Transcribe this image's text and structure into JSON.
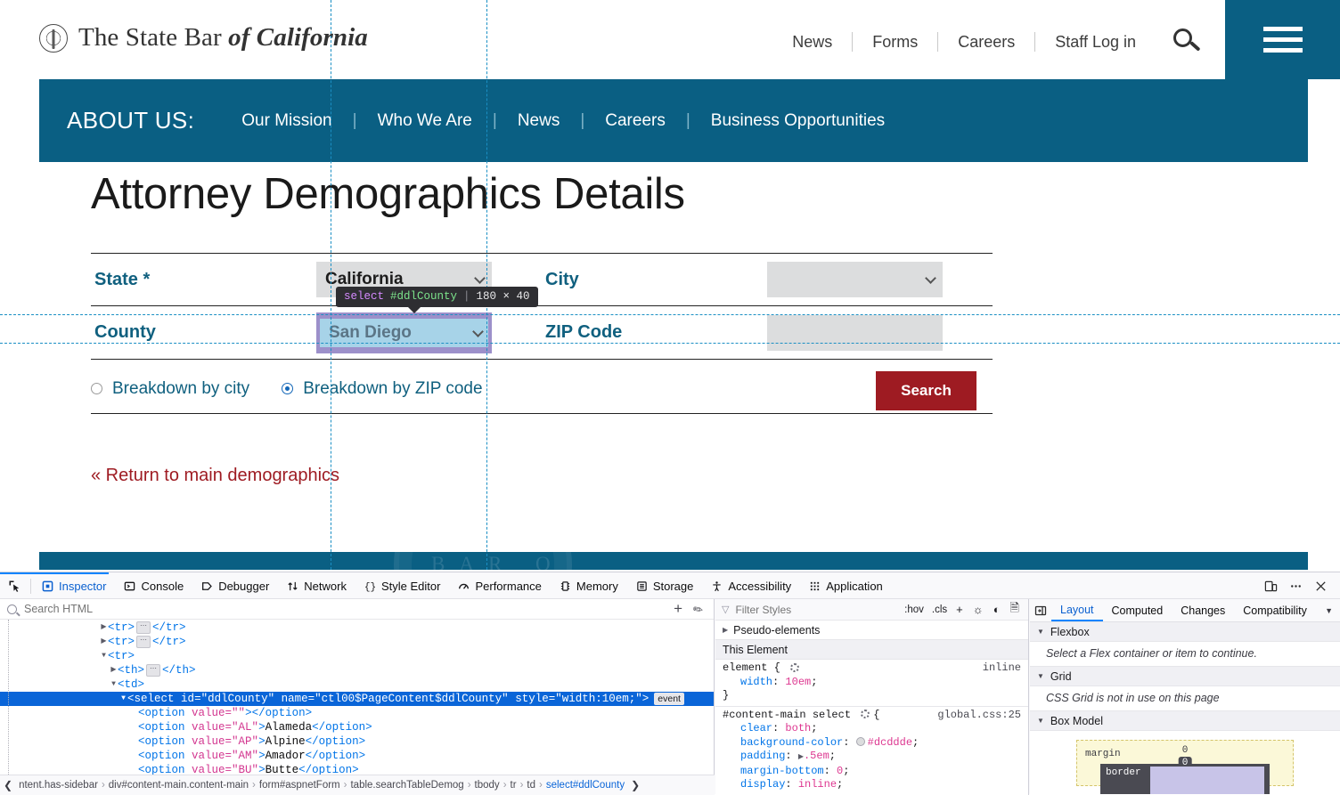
{
  "site": {
    "brand_prefix": "The State Bar ",
    "brand_emphasis": "of California",
    "seal_icon": "state-bar-seal-icon",
    "util_nav": [
      "News",
      "Forms",
      "Careers",
      "Staff Log in"
    ],
    "search_icon": "search-icon",
    "menu_icon": "hamburger-menu-icon",
    "section_label": "ABOUT US:",
    "section_nav": [
      "Our Mission",
      "Who We Are",
      "News",
      "Careers",
      "Business Opportunities"
    ],
    "teal": "#0a5f83",
    "crimson": "#9e1b22",
    "link_teal": "#10607f",
    "watermark_text": "BAR O"
  },
  "content": {
    "page_title": "Attorney Demographics Details",
    "fields": [
      {
        "label": "State *",
        "value": "California",
        "name": "state-select",
        "chevron": true,
        "inspected": false
      },
      {
        "label": "City",
        "value": "",
        "name": "city-select",
        "chevron": true,
        "inspected": false
      },
      {
        "label": "County",
        "value": "San Diego",
        "name": "county-select",
        "chevron": true,
        "inspected": true
      },
      {
        "label": "ZIP Code",
        "value": "",
        "name": "zip-select",
        "chevron": false,
        "inspected": false
      }
    ],
    "radios": [
      {
        "label": "Breakdown by city",
        "selected": false
      },
      {
        "label": "Breakdown by ZIP code",
        "selected": true
      }
    ],
    "search_button": "Search",
    "return_link": "« Return to main demographics"
  },
  "highlighter": {
    "infobar": {
      "tag": "select",
      "id": "#ddlCounty",
      "separator": "|",
      "dimensions": "180 × 40"
    },
    "content_color": "#a7d3e8",
    "padding_color": "#9c90ca",
    "guide_color": "#1a8fc4"
  },
  "devtools": {
    "picker_icon": "element-picker-icon",
    "tabs": [
      {
        "label": "Inspector",
        "icon": "inspector-icon",
        "active": true
      },
      {
        "label": "Console",
        "icon": "console-icon",
        "active": false
      },
      {
        "label": "Debugger",
        "icon": "debugger-icon",
        "active": false
      },
      {
        "label": "Network",
        "icon": "network-icon",
        "active": false
      },
      {
        "label": "Style Editor",
        "icon": "style-editor-icon",
        "active": false
      },
      {
        "label": "Performance",
        "icon": "performance-icon",
        "active": false
      },
      {
        "label": "Memory",
        "icon": "memory-icon",
        "active": false
      },
      {
        "label": "Storage",
        "icon": "storage-icon",
        "active": false
      },
      {
        "label": "Accessibility",
        "icon": "accessibility-icon",
        "active": false
      },
      {
        "label": "Application",
        "icon": "application-icon",
        "active": false
      }
    ],
    "right_buttons": [
      {
        "icon": "responsive-design-mode-icon"
      },
      {
        "icon": "meatball-menu-icon"
      },
      {
        "icon": "close-devtools-icon"
      }
    ],
    "markup": {
      "search_placeholder": "Search HTML",
      "add_node_icon": "plus-icon",
      "eyedropper_icon": "eyedropper-icon",
      "nodes": [
        {
          "indent": 7,
          "twisty": "collapsed",
          "text": "<tr>",
          "collapsed_children": true,
          "close": "</tr>"
        },
        {
          "indent": 7,
          "twisty": "collapsed",
          "text": "<tr>",
          "collapsed_children": true,
          "close": "</tr>"
        },
        {
          "indent": 7,
          "twisty": "expanded",
          "text": "<tr>",
          "collapsed_children": false,
          "close": ""
        },
        {
          "indent": 8,
          "twisty": "collapsed",
          "text": "<th>",
          "collapsed_children": true,
          "close": "</th>"
        },
        {
          "indent": 8,
          "twisty": "expanded",
          "text": "<td>",
          "collapsed_children": false,
          "close": ""
        }
      ],
      "selected_node": {
        "tag": "select",
        "attrs": [
          {
            "name": "id",
            "value": "\"ddlCounty\""
          },
          {
            "name": "name",
            "value": "\"ctl00$PageContent$ddlCounty\""
          },
          {
            "name": "style",
            "value": "\"width:10em;\""
          }
        ],
        "badge": "event"
      },
      "options": [
        {
          "attr": "value=\"\"",
          "text": ""
        },
        {
          "attr": "value=\"AL\"",
          "text": "Alameda"
        },
        {
          "attr": "value=\"AP\"",
          "text": "Alpine"
        },
        {
          "attr": "value=\"AM\"",
          "text": "Amador"
        },
        {
          "attr": "value=\"BU\"",
          "text": "Butte"
        }
      ],
      "breadcrumb": [
        "ntent.has-sidebar",
        "div#content-main.content-main",
        "form#aspnetForm",
        "table.searchTableDemog",
        "tbody",
        "tr",
        "td",
        "select#ddlCounty"
      ],
      "breadcrumb_active_index": 7
    },
    "styles": {
      "filter_placeholder": "Filter Styles",
      "filter_icon": "funnel-icon",
      "hov_label": ":hov",
      "cls_label": ".cls",
      "add_rule_icon": "plus-icon",
      "light_scheme_icon": "sun-icon",
      "dark_scheme_icon": "contrast-icon",
      "print_media_icon": "page-icon",
      "pseudo_elements_label": "Pseudo-elements",
      "this_element_label": "This Element",
      "rules": [
        {
          "selector": "element {",
          "origin": "inline",
          "declarations": [
            {
              "prop": "width",
              "value": "10em",
              "swatch": null,
              "expander": false
            }
          ],
          "close": "}"
        },
        {
          "selector": "#content-main select",
          "origin": "global.css:25",
          "declarations": [
            {
              "prop": "clear",
              "value": "both",
              "swatch": null,
              "expander": false
            },
            {
              "prop": "background-color",
              "value": "#dcddde",
              "swatch": "#dcddde",
              "expander": false
            },
            {
              "prop": "padding",
              "value": ".5em",
              "swatch": null,
              "expander": true
            },
            {
              "prop": "margin-bottom",
              "value": "0",
              "swatch": null,
              "expander": false
            },
            {
              "prop": "display",
              "value": "inline",
              "swatch": null,
              "expander": false
            }
          ],
          "close": ""
        }
      ]
    },
    "layout": {
      "toggle_sidebar_icon": "toggle-sidebar-icon",
      "tabs": [
        {
          "label": "Layout",
          "active": true
        },
        {
          "label": "Computed",
          "active": false
        },
        {
          "label": "Changes",
          "active": false
        },
        {
          "label": "Compatibility",
          "active": false
        }
      ],
      "overflow_icon": "chevron-down-icon",
      "sections": [
        {
          "title": "Flexbox",
          "body": "Select a Flex container or item to continue."
        },
        {
          "title": "Grid",
          "body": "CSS Grid is not in use on this page"
        },
        {
          "title": "Box Model",
          "body": ""
        }
      ],
      "box_model": {
        "margin_label": "margin",
        "margin_top": "0",
        "border_label": "border",
        "border_top": "0"
      }
    }
  }
}
